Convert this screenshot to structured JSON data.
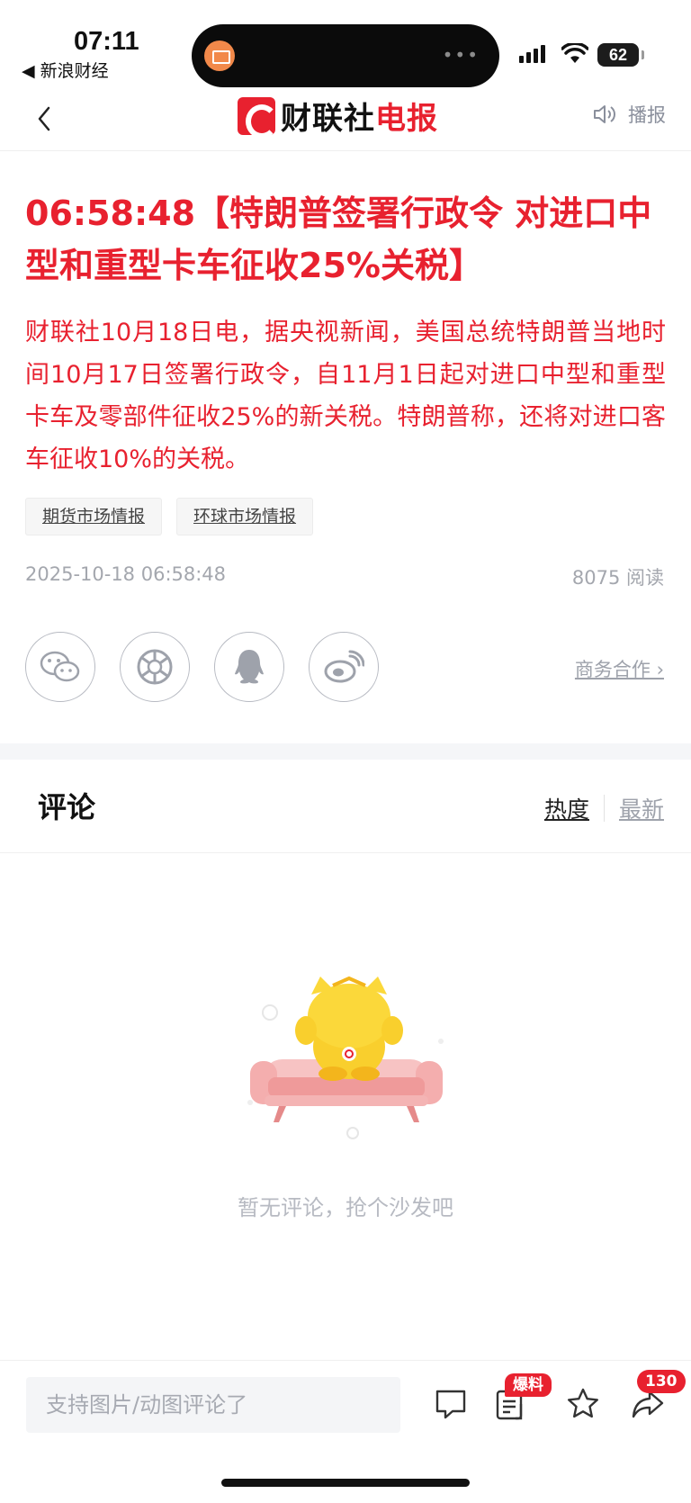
{
  "status_bar": {
    "time": "07:11",
    "back_app": "◀ 新浪财经",
    "battery": "62"
  },
  "nav": {
    "logo_part1": "财联社",
    "logo_part2": "电报",
    "play_label": "播报"
  },
  "article": {
    "title": "06:58:48【特朗普签署行政令  对进口中型和重型卡车征收25%关税】",
    "body": "财联社10月18日电，据央视新闻，美国总统特朗普当地时间10月17日签署行政令，自11月1日起对进口中型和重型卡车及零部件征收25%的新关税。特朗普称，还将对进口客车征收10%的关税。",
    "tags": [
      "期货市场情报",
      "环球市场情报"
    ],
    "date": "2025-10-18 06:58:48",
    "reads": "8075 阅读",
    "business_link": "商务合作 ›"
  },
  "share": [
    "wechat-icon",
    "moments-icon",
    "qq-icon",
    "weibo-icon"
  ],
  "comments": {
    "title": "评论",
    "sort_hot": "热度",
    "sort_new": "最新",
    "empty_text": "暂无评论，抢个沙发吧"
  },
  "bottom_bar": {
    "input_placeholder": "支持图片/动图评论了",
    "report_badge": "爆料",
    "share_count": "130"
  },
  "colors": {
    "accent": "#e8212f",
    "muted": "#a4a7ae"
  }
}
